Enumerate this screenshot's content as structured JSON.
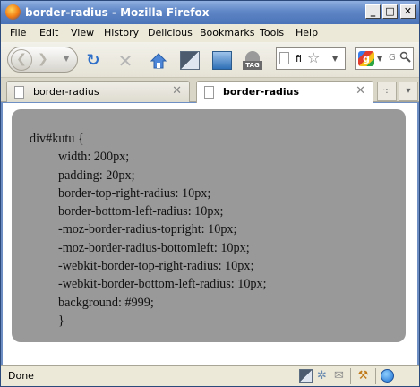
{
  "window": {
    "title": "border-radius - Mozilla Firefox",
    "min_label": "_",
    "max_label": "□",
    "close_label": "✕"
  },
  "menu": {
    "items": [
      "File",
      "Edit",
      "View",
      "History",
      "Delicious",
      "Bookmarks",
      "Tools",
      "Help"
    ]
  },
  "navbar": {
    "url_value": "fi",
    "search_placeholder": "G",
    "tag_label": "TAG"
  },
  "tabs": [
    {
      "label": "border-radius",
      "active": false
    },
    {
      "label": "border-radius",
      "active": true
    }
  ],
  "content": {
    "selector": "div#kutu {",
    "declarations": [
      "width: 200px;",
      "padding: 20px;",
      "border-top-right-radius: 10px;",
      "border-bottom-left-radius: 10px;",
      "-moz-border-radius-topright: 10px;",
      "-moz-border-radius-bottomleft: 10px;",
      "-webkit-border-top-right-radius: 10px;",
      "-webkit-border-bottom-left-radius: 10px;",
      "background: #999;"
    ],
    "closing": "}",
    "box_color": "#999999"
  },
  "status": {
    "text": "Done"
  }
}
